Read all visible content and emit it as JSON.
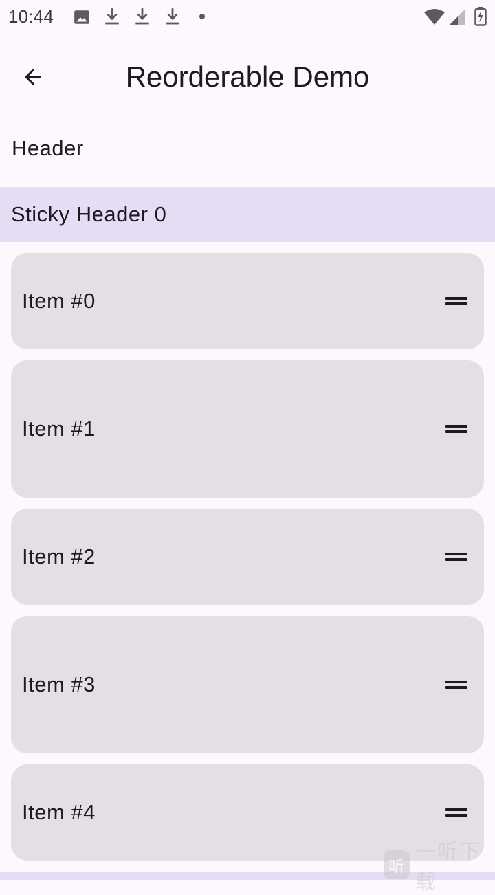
{
  "status_bar": {
    "time": "10:44",
    "icons_left": [
      "image-icon",
      "download-icon",
      "download-icon",
      "download-icon",
      "dot-icon"
    ],
    "icons_right": [
      "wifi-icon",
      "cell-signal-icon",
      "battery-charging-icon"
    ]
  },
  "app_bar": {
    "title": "Reorderable Demo",
    "back_icon": "arrow-back-icon"
  },
  "list": {
    "header": "Header",
    "sticky_header": "Sticky Header 0",
    "items": [
      {
        "label": "Item #0"
      },
      {
        "label": "Item #1"
      },
      {
        "label": "Item #2"
      },
      {
        "label": "Item #3"
      },
      {
        "label": "Item #4"
      }
    ],
    "handle_icon": "drag-handle-icon"
  },
  "watermark": {
    "badge": "听",
    "text": "一听下载"
  },
  "colors": {
    "background": "#fdf7fe",
    "sticky_header": "#e6ddf5",
    "item_card": "#e3dfe5",
    "text": "#1d1b20"
  }
}
